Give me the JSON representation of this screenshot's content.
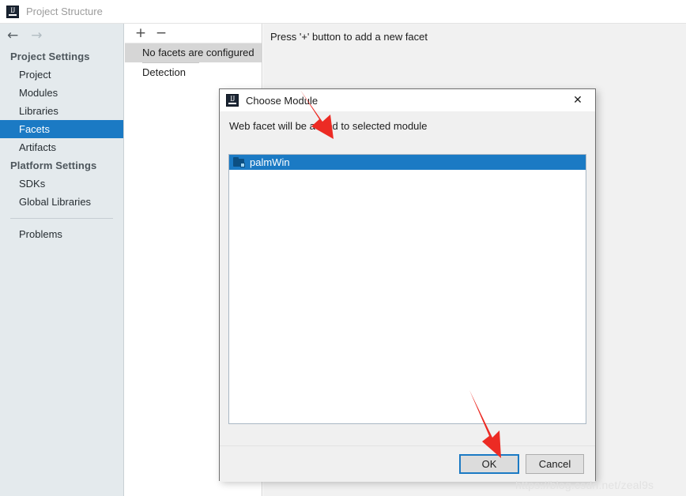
{
  "window": {
    "title": "Project Structure",
    "app_icon": "intellij-idea-logo-icon",
    "logo_text": "IJ"
  },
  "nav": {
    "back_icon": "arrow-left-icon",
    "back_glyph": "←",
    "forward_icon": "arrow-right-icon",
    "forward_glyph": "→"
  },
  "sidebar": {
    "groups": [
      {
        "label": "Project Settings",
        "items": [
          {
            "label": "Project",
            "selected": false
          },
          {
            "label": "Modules",
            "selected": false
          },
          {
            "label": "Libraries",
            "selected": false
          },
          {
            "label": "Facets",
            "selected": true
          },
          {
            "label": "Artifacts",
            "selected": false
          }
        ]
      },
      {
        "label": "Platform Settings",
        "items": [
          {
            "label": "SDKs",
            "selected": false
          },
          {
            "label": "Global Libraries",
            "selected": false
          }
        ]
      }
    ],
    "footer_items": [
      {
        "label": "Problems",
        "selected": false
      }
    ]
  },
  "facets_panel": {
    "toolbar": {
      "add_label": "+",
      "add_icon": "plus-icon",
      "remove_label": "−",
      "remove_icon": "minus-icon"
    },
    "header": "No facets are configured",
    "rows": [
      {
        "label": "Detection"
      }
    ]
  },
  "content": {
    "hint": "Press '+' button to add a new facet"
  },
  "dialog": {
    "icon": "intellij-idea-logo-icon",
    "logo_text": "IJ",
    "title": "Choose Module",
    "close_icon": "close-icon",
    "close_glyph": "✕",
    "description": "Web facet will be added to selected module",
    "list": [
      {
        "label": "palmWin",
        "icon": "module-folder-icon",
        "selected": true
      }
    ],
    "buttons": {
      "ok": "OK",
      "cancel": "Cancel"
    }
  },
  "annotations": {
    "arrow_color": "#ec2b24",
    "arrow_1_target": "palmWin list row",
    "arrow_2_target": "OK button"
  },
  "watermark": {
    "text": "https://blog.csdn.net/zeal9s"
  },
  "colors": {
    "selection_blue": "#1b7ac4",
    "sidebar_bg": "#e4eaed",
    "panel_bg": "#f1f1f1",
    "dialog_bg": "#f0f0f0",
    "facet_header_bg": "#d6d6d6",
    "arrow_red": "#ec2b24"
  }
}
